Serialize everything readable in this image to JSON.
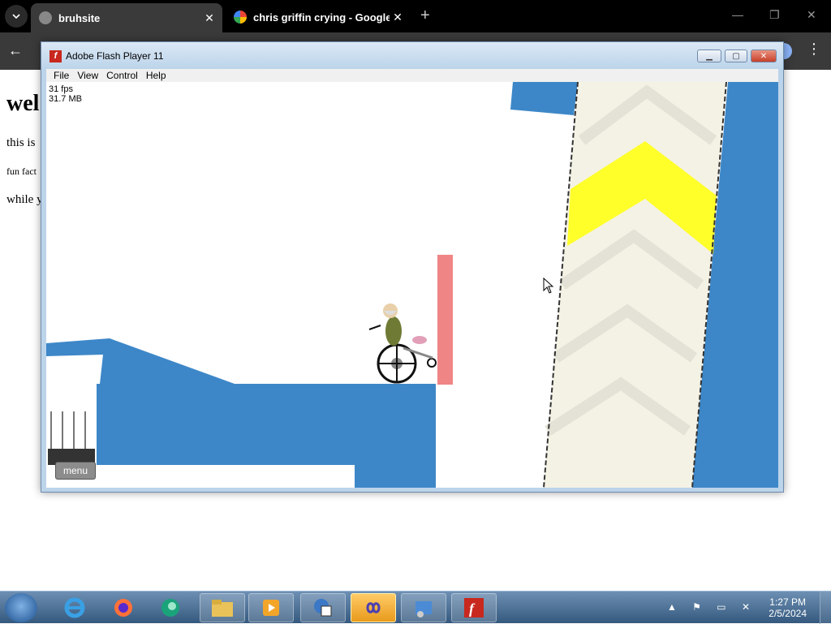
{
  "browser": {
    "tabs": [
      {
        "title": "bruhsite",
        "active": true
      },
      {
        "title": "chris griffin crying - Google Se",
        "active": false
      }
    ],
    "page": {
      "heading": "wel",
      "lines": [
        "this is",
        "fun fact",
        "while y"
      ]
    }
  },
  "flash": {
    "window_title": "Adobe Flash Player 11",
    "menu": [
      "File",
      "View",
      "Control",
      "Help"
    ],
    "stats": {
      "fps": "31 fps",
      "memory": "31.7 MB"
    },
    "menu_button": "menu",
    "colors": {
      "blue": "#3d87c8",
      "pink": "#f08585",
      "yellow": "#ffff2a",
      "cream": "#f4f2e4"
    }
  },
  "taskbar": {
    "time": "1:27 PM",
    "date": "2/5/2024"
  }
}
